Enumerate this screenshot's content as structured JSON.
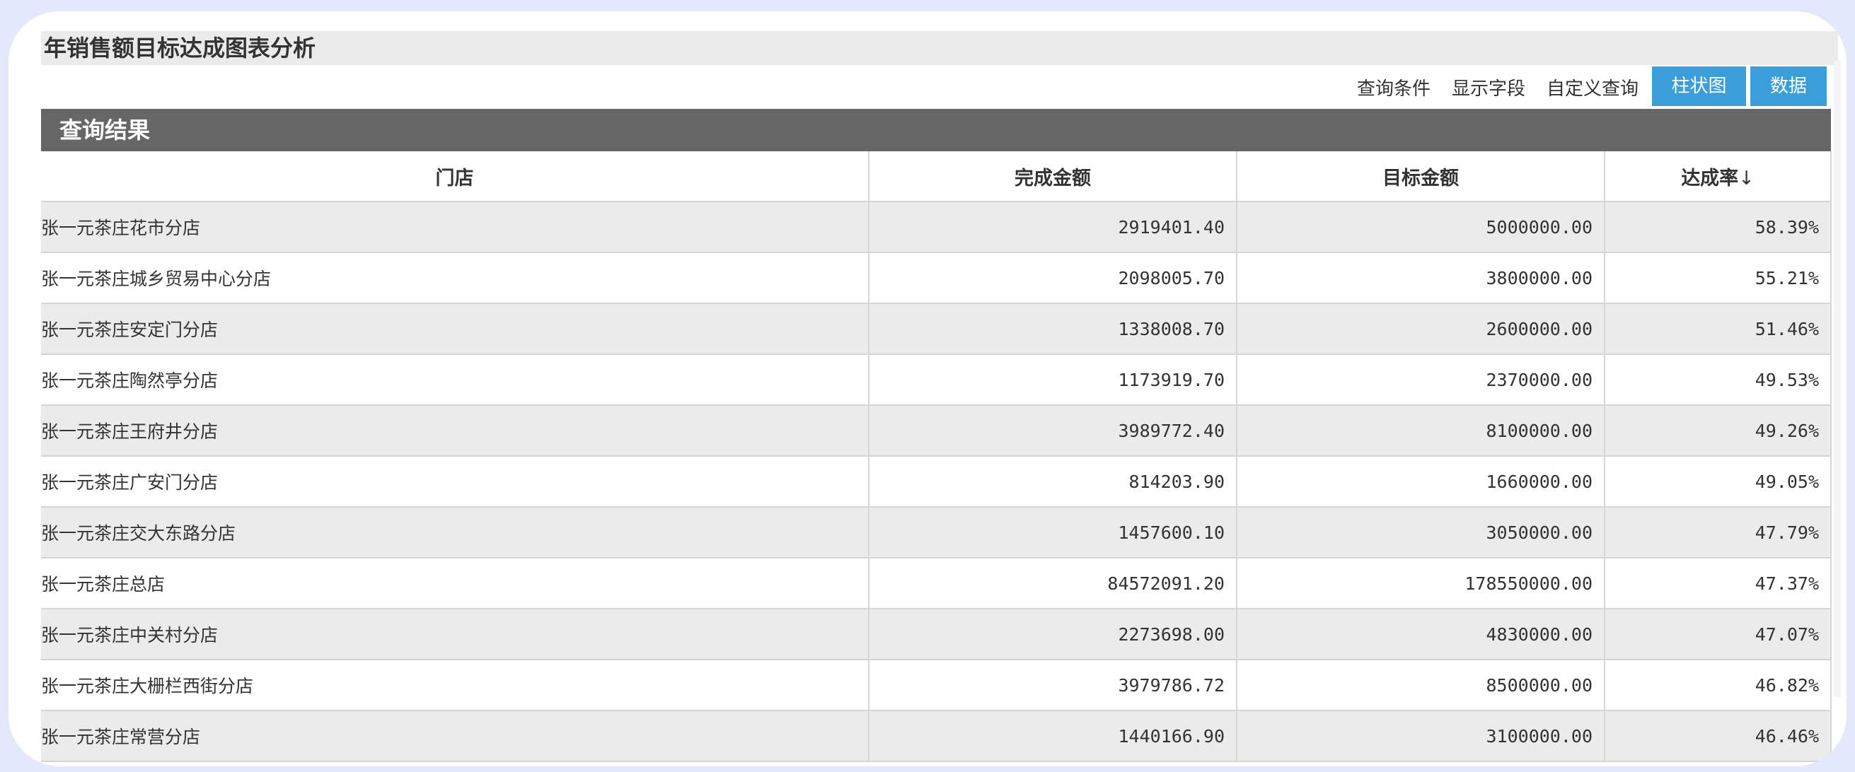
{
  "page": {
    "title": "年销售额目标达成图表分析"
  },
  "toolbar": {
    "query_conditions": "查询条件",
    "display_fields": "显示字段",
    "custom_query": "自定义查询",
    "chart_button": "柱状图",
    "data_button": "数据",
    "button_color": "#3b9ed8"
  },
  "results": {
    "header": "查询结果",
    "columns": [
      "门店",
      "完成金额",
      "目标金额",
      "达成率"
    ],
    "sort_indicator": "↓",
    "rows": [
      {
        "store": "张一元茶庄花市分店",
        "completed": "2919401.40",
        "target": "5000000.00",
        "rate": "58.39%"
      },
      {
        "store": "张一元茶庄城乡贸易中心分店",
        "completed": "2098005.70",
        "target": "3800000.00",
        "rate": "55.21%"
      },
      {
        "store": "张一元茶庄安定门分店",
        "completed": "1338008.70",
        "target": "2600000.00",
        "rate": "51.46%"
      },
      {
        "store": "张一元茶庄陶然亭分店",
        "completed": "1173919.70",
        "target": "2370000.00",
        "rate": "49.53%"
      },
      {
        "store": "张一元茶庄王府井分店",
        "completed": "3989772.40",
        "target": "8100000.00",
        "rate": "49.26%"
      },
      {
        "store": "张一元茶庄广安门分店",
        "completed": "814203.90",
        "target": "1660000.00",
        "rate": "49.05%"
      },
      {
        "store": "张一元茶庄交大东路分店",
        "completed": "1457600.10",
        "target": "3050000.00",
        "rate": "47.79%"
      },
      {
        "store": "张一元茶庄总店",
        "completed": "84572091.20",
        "target": "178550000.00",
        "rate": "47.37%"
      },
      {
        "store": "张一元茶庄中关村分店",
        "completed": "2273698.00",
        "target": "4830000.00",
        "rate": "47.07%"
      },
      {
        "store": "张一元茶庄大栅栏西街分店",
        "completed": "3979786.72",
        "target": "8500000.00",
        "rate": "46.82%"
      },
      {
        "store": "张一元茶庄常营分店",
        "completed": "1440166.90",
        "target": "3100000.00",
        "rate": "46.46%"
      }
    ]
  }
}
